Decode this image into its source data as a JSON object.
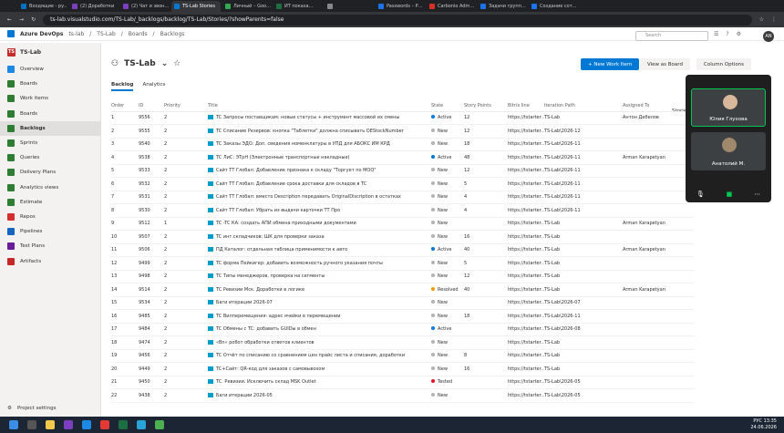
{
  "browser": {
    "tabs": [
      "Входящие - ру…",
      "(2) Доработки",
      "(2) Чат и звон…",
      "TS-Lab Stories",
      "Личный – Goo…",
      "ИТ показа…",
      "",
      "Passwords – P…",
      "Carbonio Adm…",
      "Задачи групп…",
      "Создание сот…"
    ],
    "url": "ts-lab.visualstudio.com/TS-Lab/_backlogs/backlog/TS-Lab/Stories/?showParents=false"
  },
  "topnav": {
    "product": "Azure DevOps",
    "org": "ts-lab",
    "crumbs": [
      "TS-Lab",
      "Boards",
      "Backlogs"
    ],
    "search_placeholder": "Search",
    "avatar": "AN"
  },
  "sidebar": {
    "project": "TS-Lab",
    "project_initials": "TS",
    "items": [
      {
        "label": "Overview",
        "color": "#1e88e5"
      },
      {
        "label": "Boards",
        "color": "#2e7d32"
      },
      {
        "label": "Work items",
        "color": "#2e7d32"
      },
      {
        "label": "Boards",
        "color": "#2e7d32"
      },
      {
        "label": "Backlogs",
        "color": "#2e7d32"
      },
      {
        "label": "Sprints",
        "color": "#2e7d32"
      },
      {
        "label": "Queries",
        "color": "#2e7d32"
      },
      {
        "label": "Delivery Plans",
        "color": "#2e7d32"
      },
      {
        "label": "Analytics views",
        "color": "#2e7d32"
      },
      {
        "label": "Estimate",
        "color": "#2e7d32"
      },
      {
        "label": "Repos",
        "color": "#d32f2f"
      },
      {
        "label": "Pipelines",
        "color": "#1565c0"
      },
      {
        "label": "Test Plans",
        "color": "#6a1b9a"
      },
      {
        "label": "Artifacts",
        "color": "#c62828"
      }
    ],
    "settings": "Project settings"
  },
  "page": {
    "title": "TS-Lab",
    "new_item": "New Work Item",
    "view_board": "View as Board",
    "column_options": "Column Options",
    "tabs": [
      "Backlog",
      "Analytics"
    ],
    "stories": "Stories"
  },
  "table": {
    "headers": [
      "Order",
      "ID",
      "Priority",
      "Title",
      "State",
      "Story Points",
      "Bitrix line",
      "Iteration Path",
      "Assigned To"
    ],
    "rows": [
      [
        "1",
        "9556",
        "2",
        "TC Запросы поставщикам: новые статусы + инструмент массовой их смены",
        "Active",
        "12",
        "https://tstarter…",
        "TS-Lab",
        "Антон Дебелов"
      ],
      [
        "2",
        "9555",
        "2",
        "TC Списание Резервов: кнопка \"Таблетки\" должна списывать OEStockNumber",
        "New",
        "12",
        "https://tstarter…",
        "TS-Lab\\2026-12",
        ""
      ],
      [
        "3",
        "9540",
        "2",
        "TC Заказы ЭДО: Доп. сведения номенклатуры в УПД для АБОКС ИМ КРД",
        "New",
        "18",
        "https://tstarter…",
        "TS-Lab\\2026-11",
        ""
      ],
      [
        "4",
        "9538",
        "2",
        "TC ЛиС: ЭТрН (Электронные транспортные накладные)",
        "Active",
        "48",
        "https://tstarter…",
        "TS-Lab\\2026-11",
        "Arman Karapetyan"
      ],
      [
        "5",
        "9533",
        "2",
        "Сайт ТТ Глобал: Добавление признака к складу \"Торгует по MOQ\"",
        "New",
        "12",
        "https://tstarter…",
        "TS-Lab\\2026-11",
        ""
      ],
      [
        "6",
        "9532",
        "2",
        "Сайт ТТ Глобал: Добавление срока доставки для складов в TC",
        "New",
        "5",
        "https://tstarter…",
        "TS-Lab\\2026-11",
        ""
      ],
      [
        "7",
        "9531",
        "2",
        "Сайт ТТ Глобал: вместо Description передавать OriginalDiscription в остатках",
        "New",
        "4",
        "https://tstarter…",
        "TS-Lab\\2026-11",
        ""
      ],
      [
        "8",
        "9530",
        "2",
        "Сайт ТТ Глобал: Убрать из выдачи карточки ТТ Про",
        "New",
        "4",
        "https://tstarter…",
        "TS-Lab\\2026-11",
        ""
      ],
      [
        "9",
        "9512",
        "1",
        "TC -TC КА: создать АПИ обмена приходными документами",
        "New",
        "",
        "https://tstarter…",
        "TS-Lab",
        "Arman Karapetyan"
      ],
      [
        "10",
        "9507",
        "2",
        "TC инт.складчиков: ШК для проверки заказа",
        "New",
        "16",
        "https://tstarter…",
        "TS-Lab",
        ""
      ],
      [
        "11",
        "9506",
        "2",
        "ПД Каталог: отдельная таблица применимости к авто",
        "Active",
        "40",
        "https://tstarter…",
        "TS-Lab",
        "Arman Karapetyan"
      ],
      [
        "12",
        "9499",
        "2",
        "TC форма Пейкигер: добавить возможность ручного указания почты",
        "New",
        "5",
        "https://tstarter…",
        "TS-Lab",
        ""
      ],
      [
        "13",
        "9498",
        "2",
        "TC Типы менеджеров, проверка на сегменты",
        "New",
        "12",
        "https://tstarter…",
        "TS-Lab",
        ""
      ],
      [
        "14",
        "9514",
        "2",
        "TC Ревизии Мск. Доработки в логике",
        "Resolved",
        "40",
        "https://tstarter…",
        "TS-Lab",
        "Arman Karapetyan"
      ],
      [
        "15",
        "9534",
        "2",
        "Баги итерации 2026-07",
        "New",
        "",
        "https://tstarter…",
        "TS-Lab\\2026-07",
        ""
      ],
      [
        "16",
        "9485",
        "2",
        "TC Вилперемещения: адрес ячейки в перемещении",
        "New",
        "18",
        "https://tstarter…",
        "TS-Lab\\2026-11",
        ""
      ],
      [
        "17",
        "9484",
        "2",
        "TC Обмены с TC: добавить GUIDы в обмен",
        "Active",
        "",
        "https://tstarter…",
        "TS-Lab\\2026-08",
        ""
      ],
      [
        "18",
        "9474",
        "2",
        "«Bn» робот обработки ответов клиентов",
        "New",
        "",
        "https://tstarter…",
        "TS-Lab",
        ""
      ],
      [
        "19",
        "9456",
        "2",
        "TC Отчёт по списанию со сравнением цен прайс листа и списания, доработки",
        "New",
        "8",
        "https://tstarter…",
        "TS-Lab",
        ""
      ],
      [
        "20",
        "9449",
        "2",
        "TC+Сайт: QR-код для заказов с самовывозом",
        "New",
        "16",
        "https://tstarter…",
        "TS-Lab",
        ""
      ],
      [
        "21",
        "9450",
        "2",
        "TC. Ревизии. Исключить склад MSK Outlet",
        "Tested",
        "",
        "https://tstarter…",
        "TS-Lab\\2026-05",
        ""
      ],
      [
        "22",
        "9438",
        "2",
        "Баги итерации 2026-05",
        "New",
        "",
        "https://tstarter…",
        "TS-Lab\\2026-05",
        ""
      ]
    ]
  },
  "state_colors": {
    "Active": "#0078d4",
    "New": "#b2b2b2",
    "Resolved": "#ff9d00",
    "Tested": "#e81123"
  },
  "video": {
    "p1": "Юлия Глухова",
    "p2": "Анатолий М."
  },
  "clock": {
    "time": "13:35",
    "date": "24.06.2026",
    "lang": "РУС"
  }
}
